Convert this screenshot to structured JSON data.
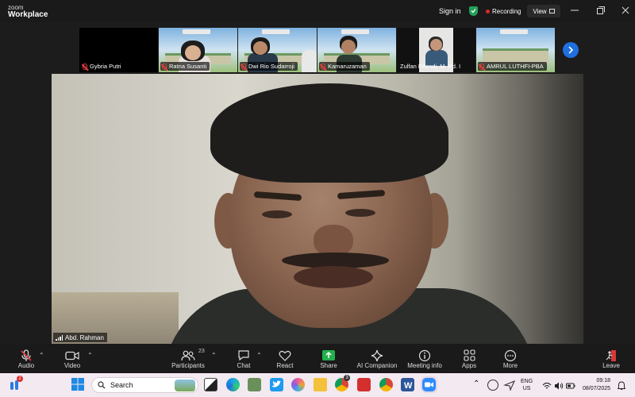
{
  "app": {
    "logo_line1": "zoom",
    "logo_line2": "Workplace"
  },
  "titlebar": {
    "sign_in": "Sign in",
    "recording": "Recording",
    "view": "View"
  },
  "participants_strip": [
    {
      "name": "Gybria Putri",
      "video": false
    },
    {
      "name": "Ratna Susanti",
      "video": true
    },
    {
      "name": "Dwi Rio Sudarroji",
      "video": true
    },
    {
      "name": "Kamaruzaman",
      "video": true
    },
    {
      "name": "Zulfan Effendi, M. Pd. I",
      "video": true
    },
    {
      "name": "AMRUL LUTHFI-PBA",
      "video": true
    }
  ],
  "main_video": {
    "name": "Abd. Rahman"
  },
  "toolbar": {
    "audio": "Audio",
    "video": "Video",
    "participants": "Participants",
    "participants_count": "23",
    "chat": "Chat",
    "react": "React",
    "share": "Share",
    "ai_companion": "AI Companion",
    "meeting_info": "Meeting info",
    "apps": "Apps",
    "more": "More",
    "leave": "Leave"
  },
  "taskbar": {
    "search_placeholder": "Search",
    "start_badge": "2",
    "chrome_badge": "3",
    "lang_line1": "ENG",
    "lang_line2": "US",
    "time": "09:18",
    "date": "08/07/2025"
  },
  "colors": {
    "accent": "#1f6fe0",
    "share_green": "#22b14c",
    "mic_off_red": "#e04040",
    "recording_red": "#e02828"
  }
}
